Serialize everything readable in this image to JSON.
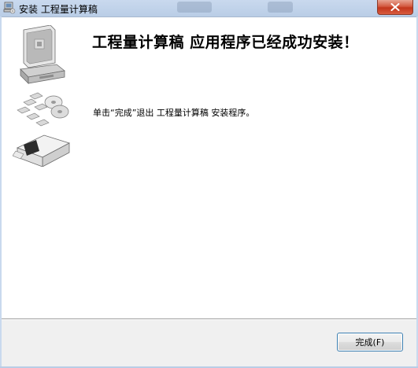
{
  "window": {
    "title": "安装 工程量计算稿"
  },
  "main": {
    "heading": "工程量计算稿 应用程序已经成功安装！",
    "message": "单击“完成”退出 工程量计算稿 安装程序。"
  },
  "footer": {
    "finish_label": "完成(F)"
  },
  "icons": {
    "app": "setup-computer-icon",
    "close": "close-icon",
    "illustration": "computer-disks-package-illustration"
  },
  "colors": {
    "titlebar": "#b9cde6",
    "close_button": "#c2361c",
    "button_border": "#3c7fb1",
    "content_bg": "#ffffff",
    "window_bg": "#f0f0f0"
  }
}
